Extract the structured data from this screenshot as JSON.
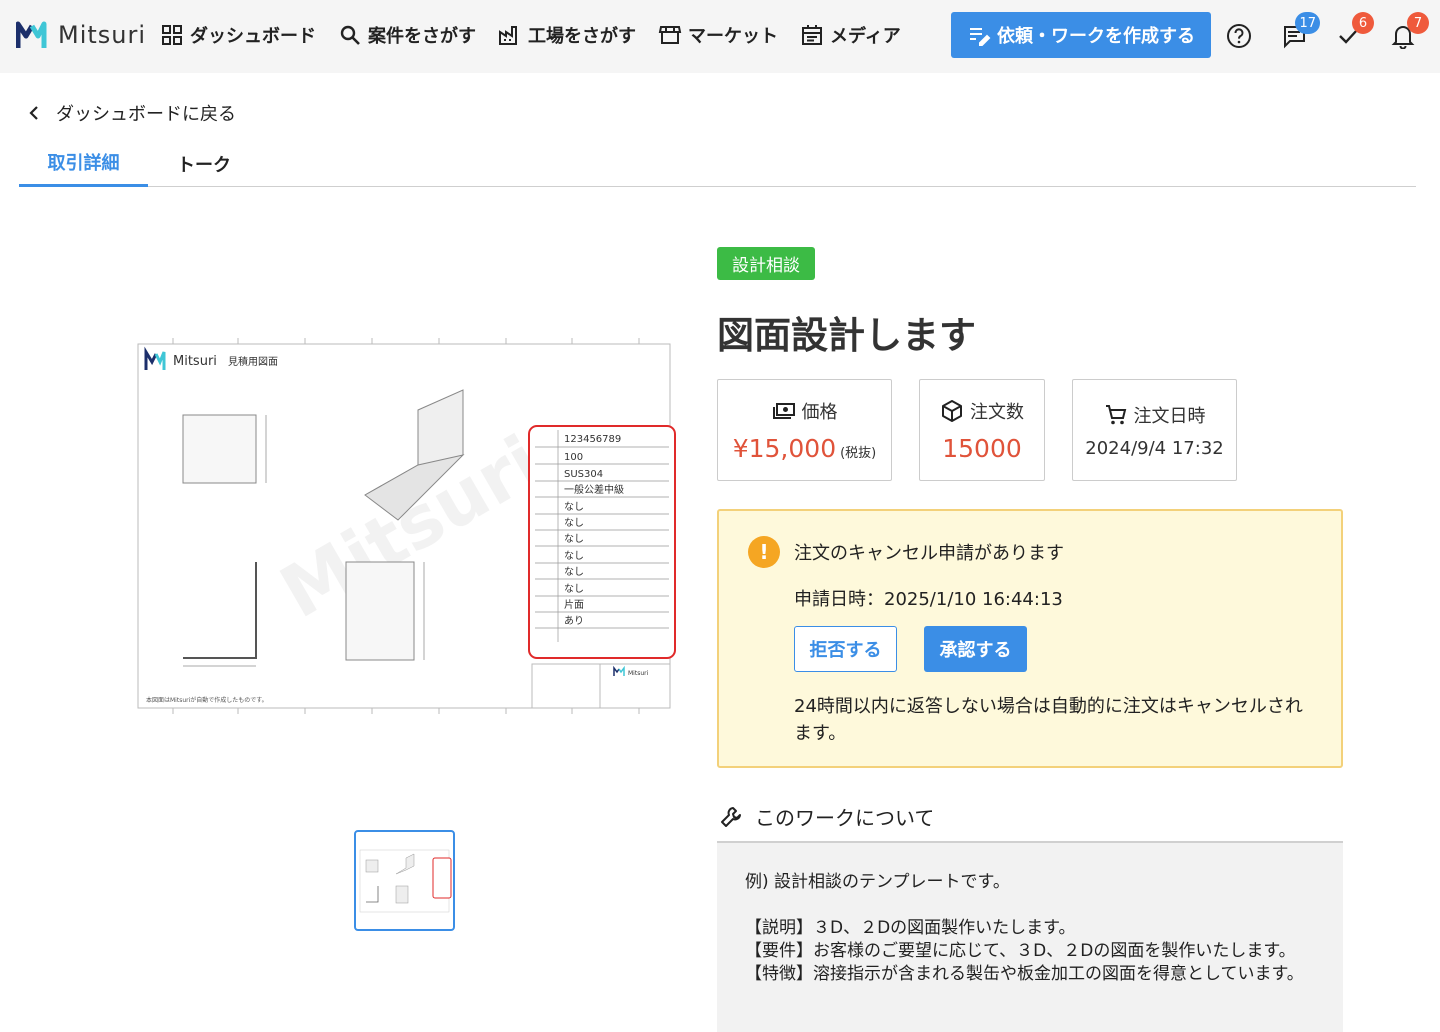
{
  "header": {
    "logo_text": "Mitsuri",
    "nav": [
      {
        "label": "ダッシュボード",
        "icon": "grid-icon"
      },
      {
        "label": "案件をさがす",
        "icon": "search-icon"
      },
      {
        "label": "工場をさがす",
        "icon": "factory-icon"
      },
      {
        "label": "マーケット",
        "icon": "store-icon"
      },
      {
        "label": "メディア",
        "icon": "calendar-icon"
      }
    ],
    "create_button": "依頼・ワークを作成する",
    "badges": {
      "messages": "17",
      "tasks": "6",
      "notifications": "7"
    },
    "colors": {
      "accent": "#3b8ee6",
      "badge_red": "#ef5a3c"
    }
  },
  "breadcrumb": {
    "back_label": "ダッシュボードに戻る"
  },
  "tabs": [
    {
      "label": "取引詳細",
      "active": true
    },
    {
      "label": "トーク",
      "active": false
    }
  ],
  "drawing": {
    "logo_text": "Mitsuri",
    "sheet_title": "見積用図面",
    "watermark": "Mitsuri",
    "footer_note": "本図面はMitsuriが自動で作成したものです。",
    "spec_values": [
      "123456789",
      "100",
      "SUS304",
      "一般公差中級",
      "なし",
      "なし",
      "なし",
      "なし",
      "なし",
      "なし",
      "片面",
      "あり",
      ""
    ],
    "stamp_text": "Mitsuri"
  },
  "work": {
    "category": "設計相談",
    "category_color": "#3cbb45",
    "title": "図面設計します",
    "price_label": "価格",
    "price_value": "¥15,000",
    "price_tax": "(税抜)",
    "quantity_label": "注文数",
    "quantity_value": "15000",
    "order_date_label": "注文日時",
    "order_date_value": "2024/9/4 17:32"
  },
  "cancel_alert": {
    "icon_symbol": "!",
    "message": "注文のキャンセル申請があります",
    "requested_at": "申請日時：2025/1/10 16:44:13",
    "reject_label": "拒否する",
    "accept_label": "承認する",
    "note": "24時間以内に返答しない場合は自動的に注文はキャンセルされます。"
  },
  "about": {
    "heading": "このワークについて",
    "body": "例) 設計相談のテンプレートです。\n\n【説明】３D、２Dの図面製作いたします。\n【要件】お客様のご要望に応じて、３D、２Dの図面を製作いたします。\n【特徴】溶接指示が含まれる製缶や板金加工の図面を得意としています。"
  }
}
